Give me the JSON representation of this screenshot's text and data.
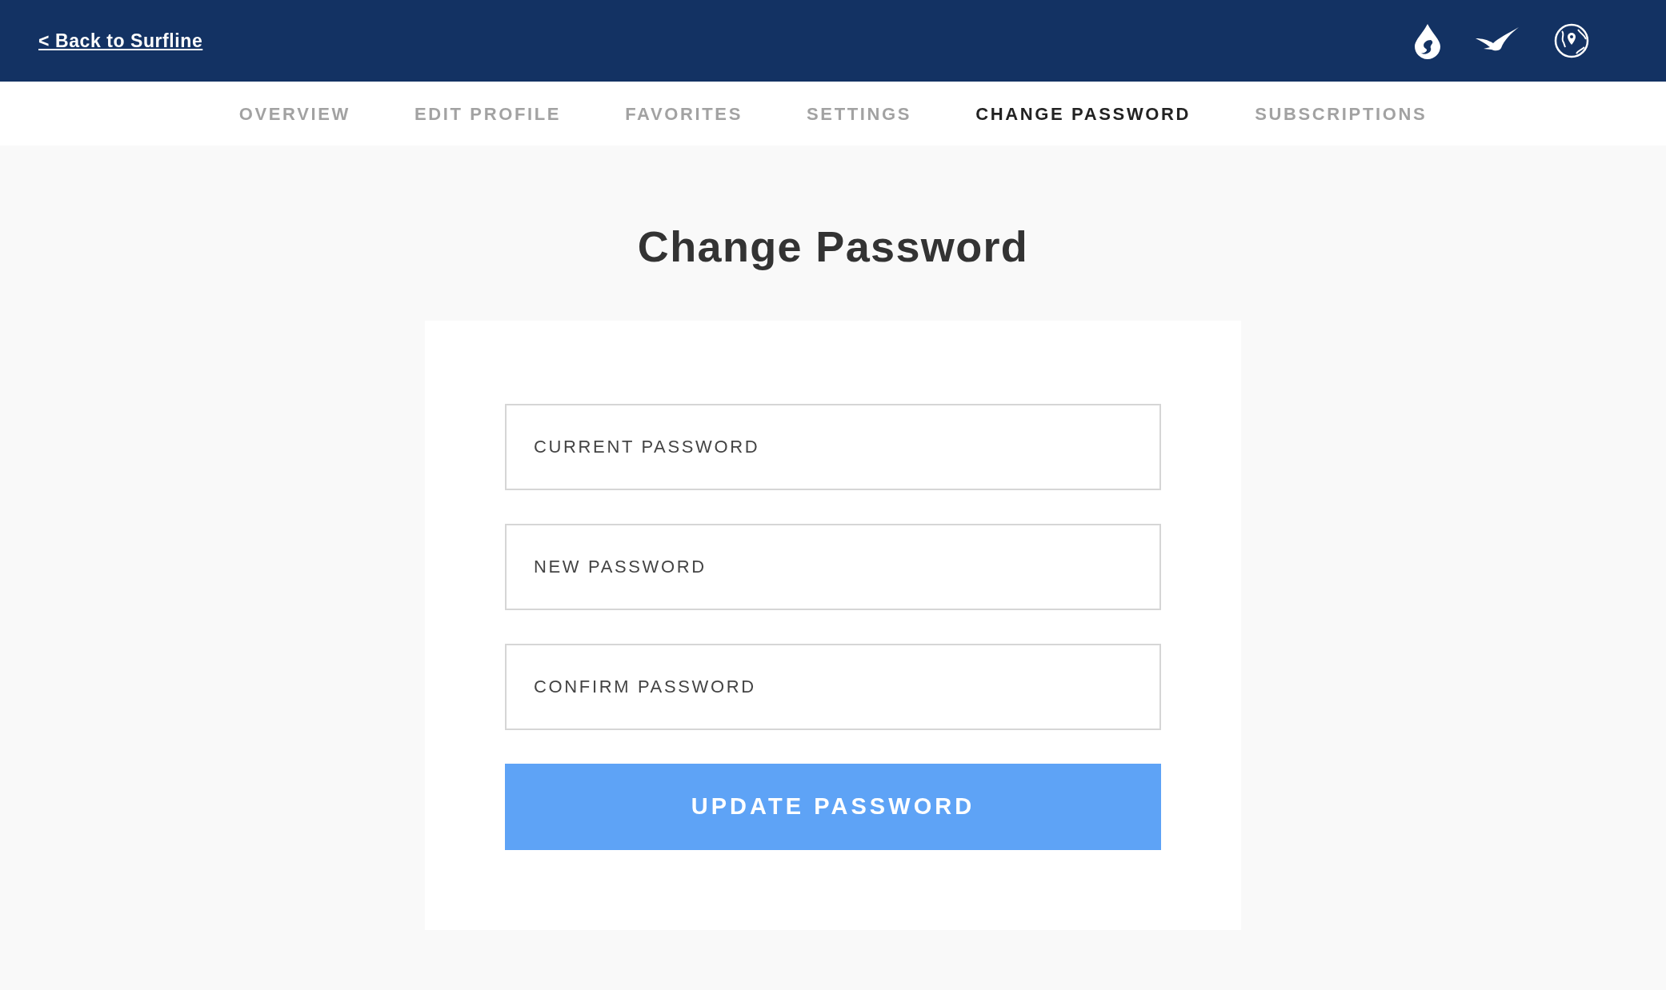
{
  "header": {
    "back_link": "< Back to Surfline"
  },
  "tabs": [
    {
      "label": "OVERVIEW",
      "selected": false
    },
    {
      "label": "EDIT PROFILE",
      "selected": false
    },
    {
      "label": "FAVORITES",
      "selected": false
    },
    {
      "label": "SETTINGS",
      "selected": false
    },
    {
      "label": "CHANGE PASSWORD",
      "selected": true
    },
    {
      "label": "SUBSCRIPTIONS",
      "selected": false
    }
  ],
  "title": "Change Password",
  "form": {
    "fields": [
      {
        "placeholder": "CURRENT PASSWORD"
      },
      {
        "placeholder": "NEW PASSWORD"
      },
      {
        "placeholder": "CONFIRM PASSWORD"
      }
    ],
    "submit": "UPDATE PASSWORD"
  }
}
